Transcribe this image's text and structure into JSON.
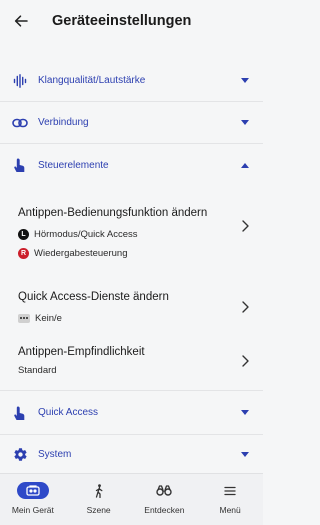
{
  "header": {
    "title": "Geräteeinstellungen"
  },
  "sections": {
    "klang": {
      "label": "Klangqualität/Lautstärke",
      "icon": "equalizer-icon"
    },
    "verbindung": {
      "label": "Verbindung",
      "icon": "link-icon"
    },
    "steuer": {
      "label": "Steuerelemente",
      "icon": "touch-icon"
    },
    "quick": {
      "label": "Quick Access",
      "icon": "touch-icon"
    },
    "system": {
      "label": "System",
      "icon": "gear-icon"
    }
  },
  "steuer_items": {
    "tap_function": {
      "title": "Antippen-Bedienungsfunktion ändern",
      "left_badge": "L",
      "left_value": "Hörmodus/Quick Access",
      "right_badge": "R",
      "right_value": "Wiedergabesteuerung"
    },
    "quick_services": {
      "title": "Quick Access-Dienste ändern",
      "value": "Kein/e"
    },
    "sensitivity": {
      "title": "Antippen-Empfindlichkeit",
      "value": "Standard"
    }
  },
  "bottom_nav": {
    "my_device": "Mein Gerät",
    "scene": "Szene",
    "discover": "Entdecken",
    "menu": "Menü"
  },
  "colors": {
    "accent": "#2c3fb0",
    "nav_active": "#2e49c8",
    "red_badge": "#cc1f2b"
  }
}
